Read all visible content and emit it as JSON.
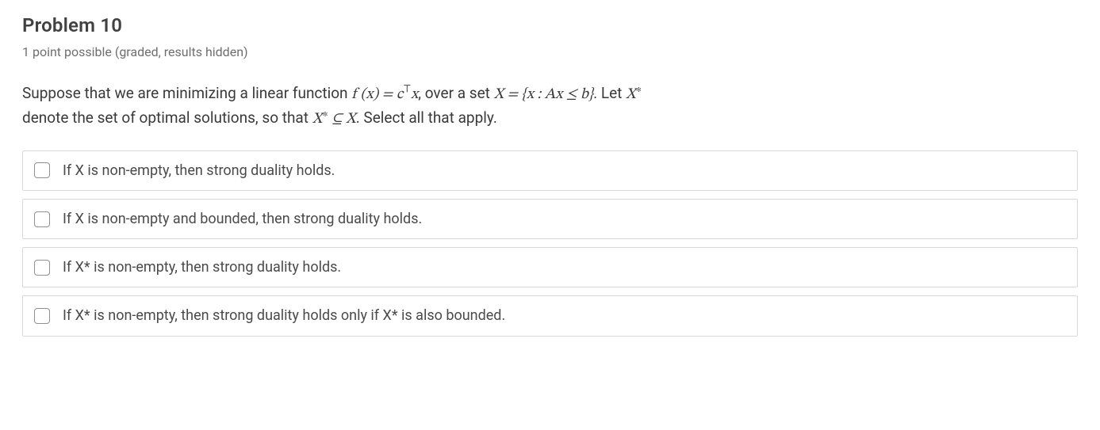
{
  "title": "Problem 10",
  "meta": "1 point possible (graded, results hidden)",
  "prompt": {
    "lead": "Suppose that we are minimizing a linear function ",
    "fx_1": "f",
    "fx_paren_open": " (",
    "fx_x": "x",
    "fx_paren_close": ")",
    "eq1": " = ",
    "c": "c",
    "top": "⊤",
    "x2": "x",
    "mid1": ", over a set ",
    "Xset": "X",
    "eq2": " = ",
    "brace_open": "{",
    "xin": "x",
    "colon": "  :  ",
    "A": "A",
    "x3": "x",
    "leq": " ≤ ",
    "b": "b",
    "brace_close": "}",
    "mid2": ". Let ",
    "Xstar": "X",
    "star": "∗",
    "line2_a": "denote the set of optimal solutions, so that ",
    "Xstar2": "X",
    "star2": "∗",
    "subset": " ⊆ ",
    "X2": "X",
    "line2_b": ". Select all that apply."
  },
  "options": [
    {
      "label": "If X is non-empty, then strong duality holds."
    },
    {
      "label": "If X is non-empty and bounded, then strong duality holds."
    },
    {
      "label": "If X* is non-empty, then strong duality holds."
    },
    {
      "label": "If X* is non-empty, then strong duality holds only if X* is also bounded."
    }
  ]
}
